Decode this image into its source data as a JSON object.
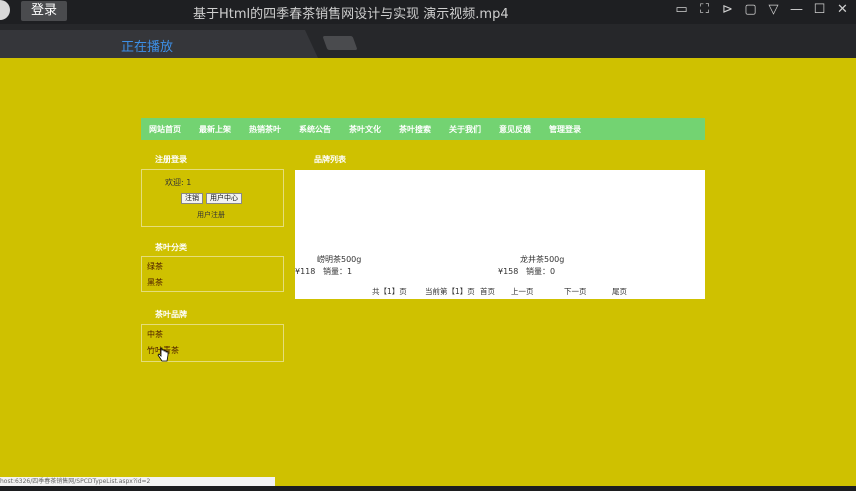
{
  "player": {
    "login_label": "登录",
    "window_title": "基于Html的四季春茶销售网设计与实现 演示视频.mp4",
    "tab_label": "正在播放"
  },
  "site": {
    "nav": [
      "网站首页",
      "最新上架",
      "热销茶叶",
      "系统公告",
      "茶叶文化",
      "茶叶搜索",
      "关于我们",
      "意见反馈",
      "管理登录"
    ],
    "login_section": {
      "heading": "注册登录",
      "welcome": "欢迎: 1",
      "logout_button": "注销",
      "user_center_button": "用户中心",
      "register_link": "用户注册"
    },
    "category_section": {
      "heading": "茶叶分类",
      "items": [
        "绿茶",
        "黑茶"
      ]
    },
    "brand_section": {
      "heading": "茶叶品牌",
      "items": [
        "中茶",
        "竹叶青茶"
      ]
    },
    "list_heading": "品牌列表",
    "products": [
      {
        "name": "崂明茶500g",
        "price": "¥118",
        "sales": "销量：1"
      },
      {
        "name": "龙井茶500g",
        "price": "¥158",
        "sales": "销量：0"
      }
    ],
    "pager": {
      "total": "共【1】页",
      "current": "当前第【1】页",
      "first": "首页",
      "prev": "上一页",
      "next": "下一页",
      "last": "尾页"
    },
    "status_url": "host:6326/四季春茶销售网/SPCDTypeList.aspx?id=2"
  }
}
